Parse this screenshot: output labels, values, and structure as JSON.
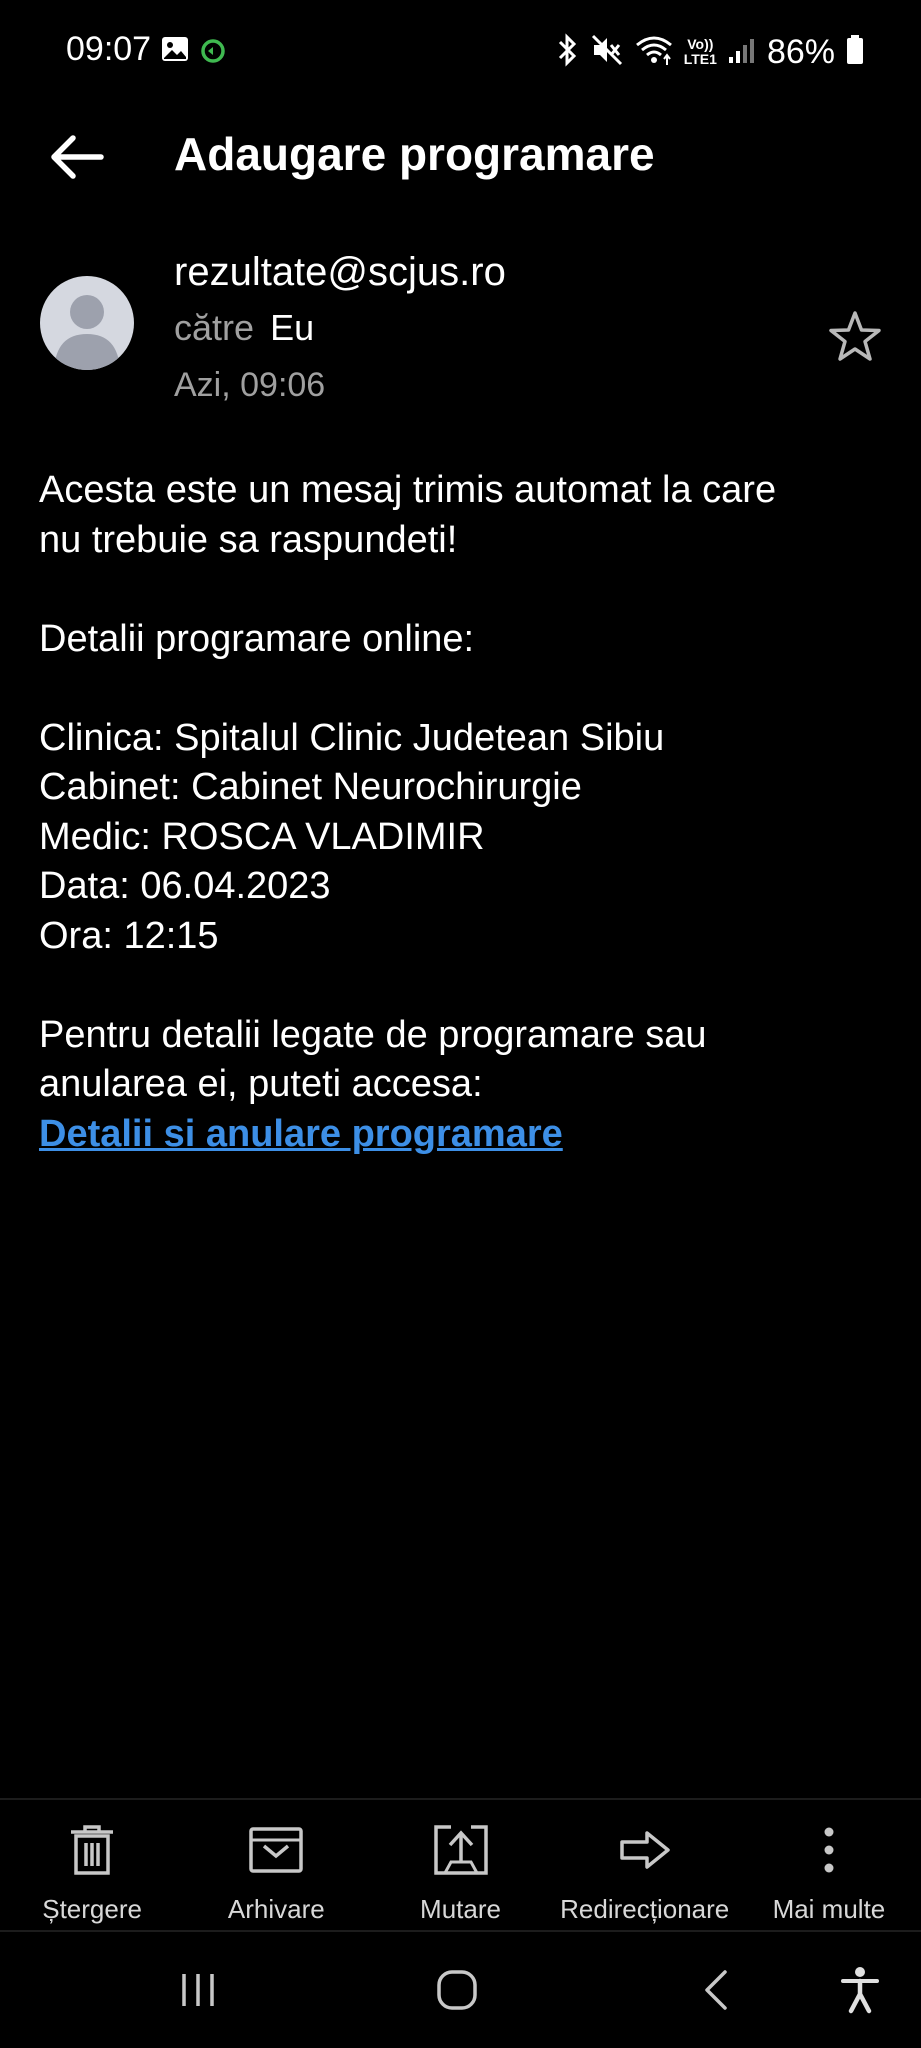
{
  "status_bar": {
    "time": "09:07",
    "battery": "86%",
    "icons": [
      "gallery-icon",
      "sync-icon",
      "bluetooth-icon",
      "mute-icon",
      "wifi-icon",
      "volte-icon",
      "signal-icon",
      "battery-icon"
    ],
    "volte_text_top": "Vo))",
    "volte_text_bottom": "LTE1"
  },
  "header": {
    "title": "Adaugare programare"
  },
  "sender": {
    "from": "rezultate@scjus.ro",
    "to_prefix": "către",
    "to_name": "Eu",
    "date": "Azi, 09:06"
  },
  "body": {
    "intro_line1": "Acesta este un mesaj trimis automat la care",
    "intro_line2": "nu trebuie sa raspundeti!",
    "details_heading": "Detalii programare online:",
    "clinic": "Clinica: Spitalul Clinic Judetean Sibiu",
    "cabinet": "Cabinet: Cabinet Neurochirurgie",
    "doctor": "Medic: ROSCA VLADIMIR",
    "date": "Data: 06.04.2023",
    "time": "Ora: 12:15",
    "footer_line1": "Pentru detalii legate de programare sau",
    "footer_line2": "anularea ei, puteti accesa:",
    "link": "Detalii si anulare programare"
  },
  "actions": [
    {
      "label": "Ștergere",
      "icon": "trash-icon"
    },
    {
      "label": "Arhivare",
      "icon": "archive-icon"
    },
    {
      "label": "Mutare",
      "icon": "move-icon"
    },
    {
      "label": "Redirecționare",
      "icon": "forward-icon"
    },
    {
      "label": "Mai multe",
      "icon": "more-icon"
    }
  ],
  "colors": {
    "background": "#000000",
    "link": "#3d8fe6",
    "secondary_text": "#a0a0a0",
    "icon": "#c8c8c8"
  }
}
